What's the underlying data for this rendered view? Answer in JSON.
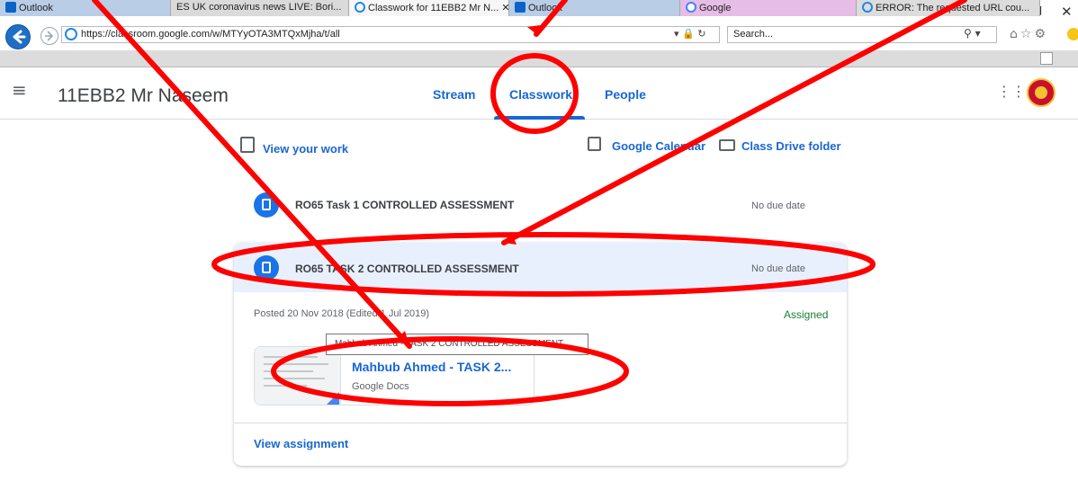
{
  "window": {
    "minimize": "–",
    "maximize": "❐",
    "close": "✕"
  },
  "browser": {
    "url": "https://classroom.google.com/w/MTYyOTA3MTQxMjha/t/all",
    "address_tools": "▾ 🔒 ↻",
    "search_placeholder": "Search...",
    "search_icon": "⚲ ▾",
    "toolbar_icons": "⌂☆⚙",
    "tabs": [
      {
        "label": "Outlook",
        "icon": "outlook-icon"
      },
      {
        "label": "ES UK coronavirus news LIVE: Bori...",
        "icon": "es-icon"
      },
      {
        "label": "Classwork for 11EBB2 Mr N...  ✕",
        "icon": "ie-icon"
      },
      {
        "label": "Outlook",
        "icon": "outlook-icon"
      },
      {
        "label": "Google",
        "icon": "google-icon"
      },
      {
        "label": "ERROR: The requested URL cou...",
        "icon": "ie-icon"
      }
    ]
  },
  "header": {
    "menu_icon": "≡",
    "class_name": "11EBB2 Mr Naseem",
    "nav": {
      "stream": "Stream",
      "classwork": "Classwork",
      "people": "People"
    },
    "apps_icon": "⋮⋮⋮"
  },
  "toolbar": {
    "view_work": "View your work",
    "calendar": "Google Calendar",
    "drive_folder": "Class Drive folder"
  },
  "assignments": [
    {
      "title": "RO65 Task 1 CONTROLLED ASSESSMENT",
      "due": "No due date"
    },
    {
      "title": "RO65 TASK 2 CONTROLLED ASSESSMENT",
      "due": "No due date",
      "posted": "Posted 20 Nov 2018 (Edited 1 Jul 2019)",
      "status": "Assigned",
      "attachment": {
        "tooltip": "Mahbub Ahmed - TASK 2 CONTROLLED ASSESSMENT",
        "name": "Mahbub Ahmed - TASK 2...",
        "type": "Google Docs"
      },
      "view_link": "View assignment"
    }
  ],
  "colors": {
    "accent": "#1967d2",
    "annotation": "#ff0000",
    "assigned_green": "#188038",
    "selected_row": "#e8f0fe"
  }
}
